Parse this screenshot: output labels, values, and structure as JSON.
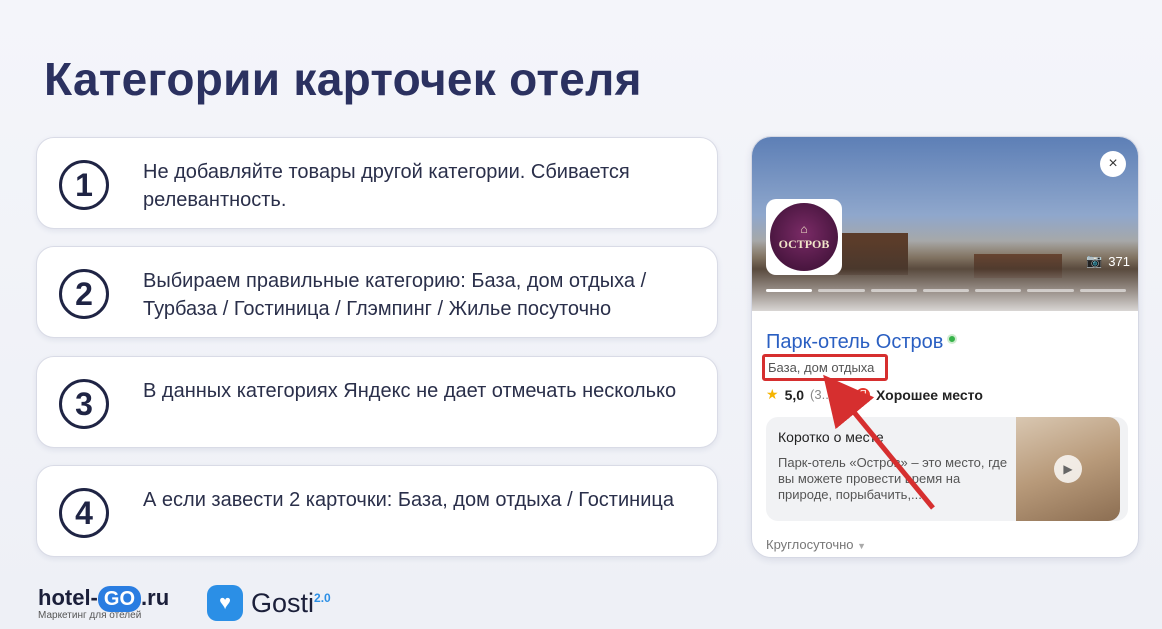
{
  "slide": {
    "title": "Категории карточек отеля"
  },
  "items": [
    {
      "number": "1",
      "text": "Не добавляйте товары другой категории. Сбивается релевантность."
    },
    {
      "number": "2",
      "text": "Выбираем правильные категорию: База, дом отдыха / Турбаза / Гостиница / Глэмпинг / Жилье посуточно"
    },
    {
      "number": "3",
      "text": "В данных категориях Яндекс не дает отмечать несколько"
    },
    {
      "number": "4",
      "text": "А если завести 2 карточки: База, дом отдыха / Гостиница"
    }
  ],
  "hotel_card": {
    "close_symbol": "×",
    "logo_text": "ОСТРОВ",
    "photo_count": "371",
    "name": "Парк-отель Остров",
    "category": "База, дом отдыха",
    "rating": "5,0",
    "reviews": "(3...8)",
    "badge_label": "Хорошее место",
    "about_title": "Коротко о месте",
    "about_text": "Парк-отель «Остров» – это место, где вы можете провести время на природе, порыбачить,...",
    "hours": "Круглосуточно",
    "highlight_color": "#d62f2f",
    "link_color": "#2a5fc2"
  },
  "footer": {
    "hotelgo_prefix": "hotel-",
    "hotelgo_go": "GO",
    "hotelgo_suffix": ".ru",
    "hotelgo_tagline": "Маркетинг для отелей",
    "gosti_name": "Gosti",
    "gosti_version": "2.0"
  },
  "colors": {
    "title": "#2b3160",
    "accent_blue": "#2a7de1"
  }
}
